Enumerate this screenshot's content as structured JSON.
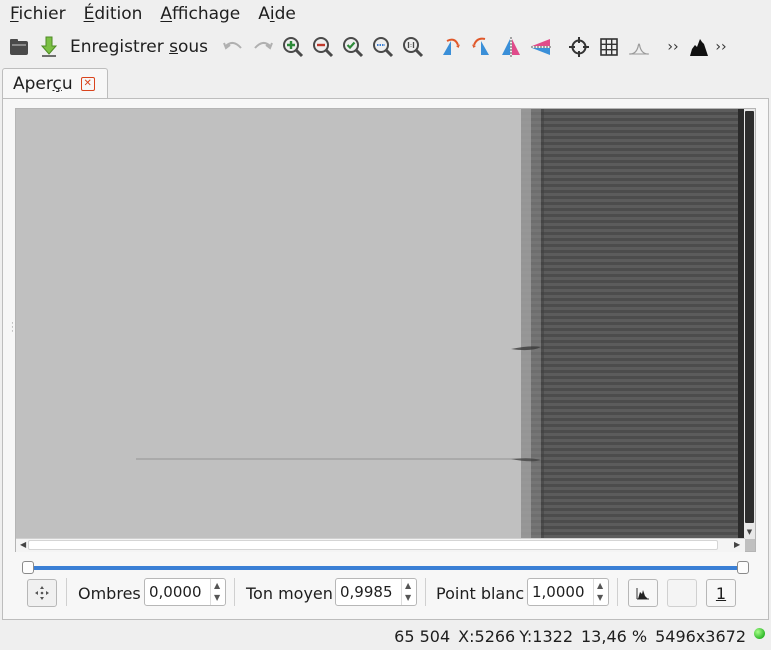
{
  "menu": {
    "file": {
      "pre": "",
      "key": "F",
      "post": "ichier"
    },
    "edit": {
      "pre": "",
      "key": "É",
      "post": "dition"
    },
    "view": {
      "pre": "",
      "key": "A",
      "post": "ffichage"
    },
    "help": {
      "pre": "A",
      "key": "i",
      "post": "de"
    }
  },
  "toolbar": {
    "save_as": {
      "pre": "Enregistrer ",
      "key": "s",
      "post": "ous"
    },
    "more": "››",
    "more2": "››"
  },
  "tab": {
    "pre": "Aper",
    "key": "ç",
    "post": "u"
  },
  "controls": {
    "shadows_label": "Ombres",
    "shadows_value": "0,0000",
    "midtone_label": "Ton moyen",
    "midtone_value": "0,9985",
    "white_label": "Point blanc",
    "white_value": "1,0000",
    "one_button": "1"
  },
  "levels": {
    "black_point": 0.0,
    "white_point": 1.0
  },
  "status": {
    "pixel_value": "65 504",
    "x": "X:5266",
    "y": "Y:1322",
    "zoom": "13,46 %",
    "size": "5496x3672"
  },
  "colors": {
    "accent": "#3a7fd5",
    "status_ok": "#2fb82a",
    "close_tab": "#d9441d"
  }
}
